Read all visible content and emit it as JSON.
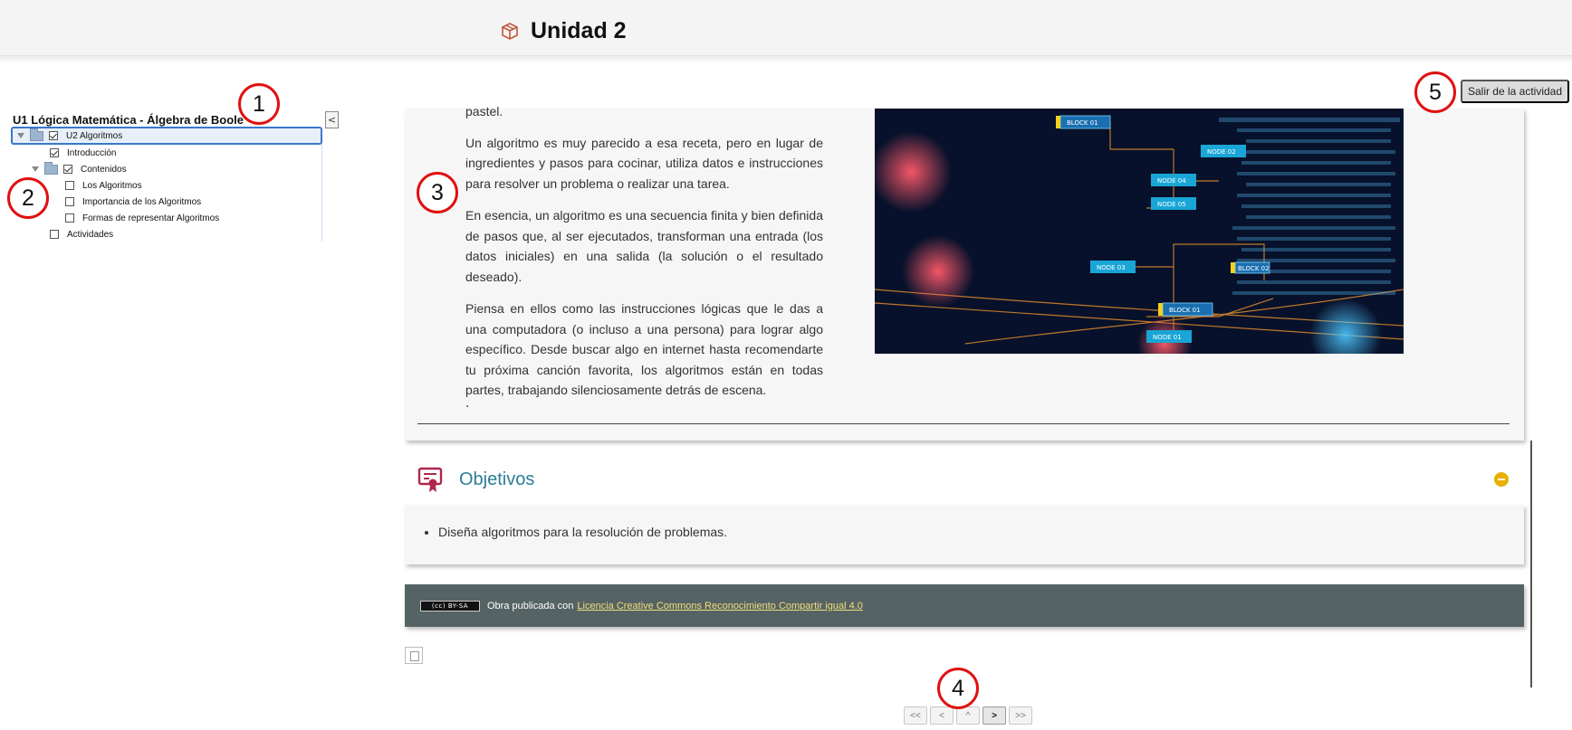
{
  "header": {
    "title": "Unidad 2",
    "icon": "box-icon"
  },
  "exit_button": {
    "label": "Salir de la actividad"
  },
  "markers": [
    "1",
    "2",
    "3",
    "4",
    "5"
  ],
  "tree": {
    "title": "U1 Lógica Matemática - Álgebra de Boole",
    "collapse_label": "<",
    "items": [
      {
        "label": "U2 Algoritmos",
        "checked": true,
        "folder": true
      },
      {
        "label": "Introducción",
        "checked": true
      },
      {
        "label": "Contenidos",
        "checked": true,
        "folder": true
      },
      {
        "label": "Los Algoritmos",
        "checked": false
      },
      {
        "label": "Importancia de los Algoritmos",
        "checked": false
      },
      {
        "label": "Formas de representar Algoritmos",
        "checked": false
      },
      {
        "label": "Actividades",
        "checked": false
      }
    ]
  },
  "content": {
    "fragment": "pastel.",
    "paragraphs": [
      "Un algoritmo es muy parecido a esa receta, pero en lugar de ingredientes y pasos para cocinar, utiliza datos e instrucciones para resolver un problema o realizar una tarea.",
      "En esencia, un algoritmo es una secuencia finita y bien definida de pasos que, al ser ejecutados, transforman una entrada (los datos iniciales) en una salida (la solución o el resultado deseado).",
      "Piensa en ellos como las instrucciones lógicas que le das a una computadora (o incluso a una persona) para lograr algo específico. Desde buscar algo en internet hasta recomendarte tu próxima canción favorita, los algoritmos están en todas partes, trabajando silenciosamente detrás de escena."
    ],
    "trailing": ".",
    "image_labels": [
      "BLOCK 01",
      "NODE 02",
      "NODE 04",
      "NODE 05",
      "NODE 03",
      "BLOCK 01",
      "NODE 01",
      "BLOCK 02"
    ]
  },
  "objectives": {
    "title": "Objetivos",
    "items": [
      "Diseña algoritmos para la resolución de problemas."
    ]
  },
  "license": {
    "badge": "BY-SA",
    "text": "Obra publicada con",
    "link": "Licencia Creative Commons Reconocimiento Compartir igual 4.0"
  },
  "pager": {
    "first": "<<",
    "prev": "<",
    "up": "^",
    "next": ">",
    "last": ">>"
  },
  "colors": {
    "accent": "#2b7e96",
    "marker": "#e01010",
    "license_bg": "#566364",
    "toggle": "#e8b000"
  }
}
